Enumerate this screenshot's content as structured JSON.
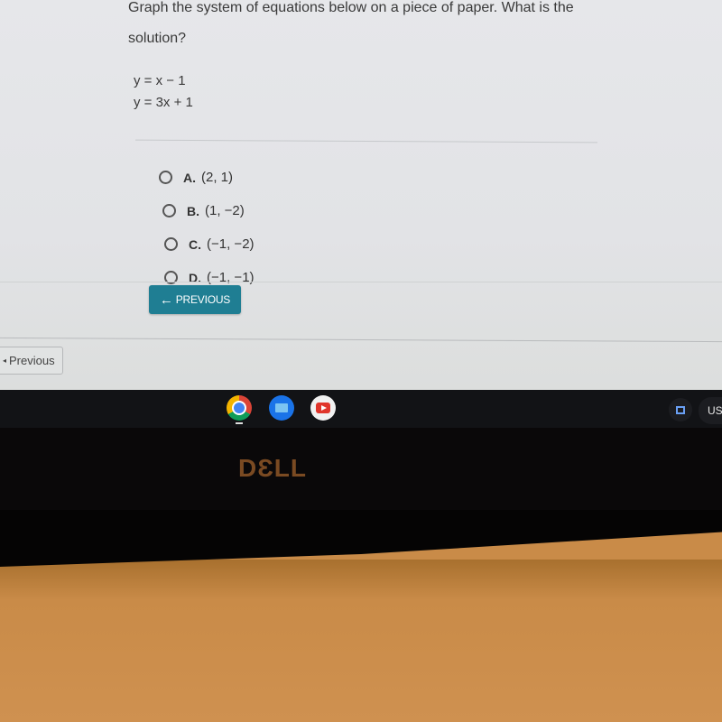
{
  "question": {
    "prompt": "Graph the system of equations below on a piece of paper. What is the solution?",
    "equations": [
      "y = x − 1",
      "y = 3x + 1"
    ]
  },
  "choices": [
    {
      "letter": "A.",
      "value": "(2, 1)",
      "selected": false
    },
    {
      "letter": "B.",
      "value": "(1, −2)",
      "selected": false
    },
    {
      "letter": "C.",
      "value": "(−1, −2)",
      "selected": false
    },
    {
      "letter": "D.",
      "value": "(−1, −1)",
      "selected": false
    }
  ],
  "buttons": {
    "previous_arrow": "←",
    "previous_label": "PREVIOUS",
    "lms_previous_icon": "◂",
    "lms_previous_label": "Previous"
  },
  "shelf": {
    "apps": [
      "chrome-icon",
      "files-icon",
      "youtube-icon"
    ],
    "status_text": "US"
  },
  "bezel": {
    "brand": "DƐLL"
  },
  "colors": {
    "accent": "#1f7e93"
  }
}
